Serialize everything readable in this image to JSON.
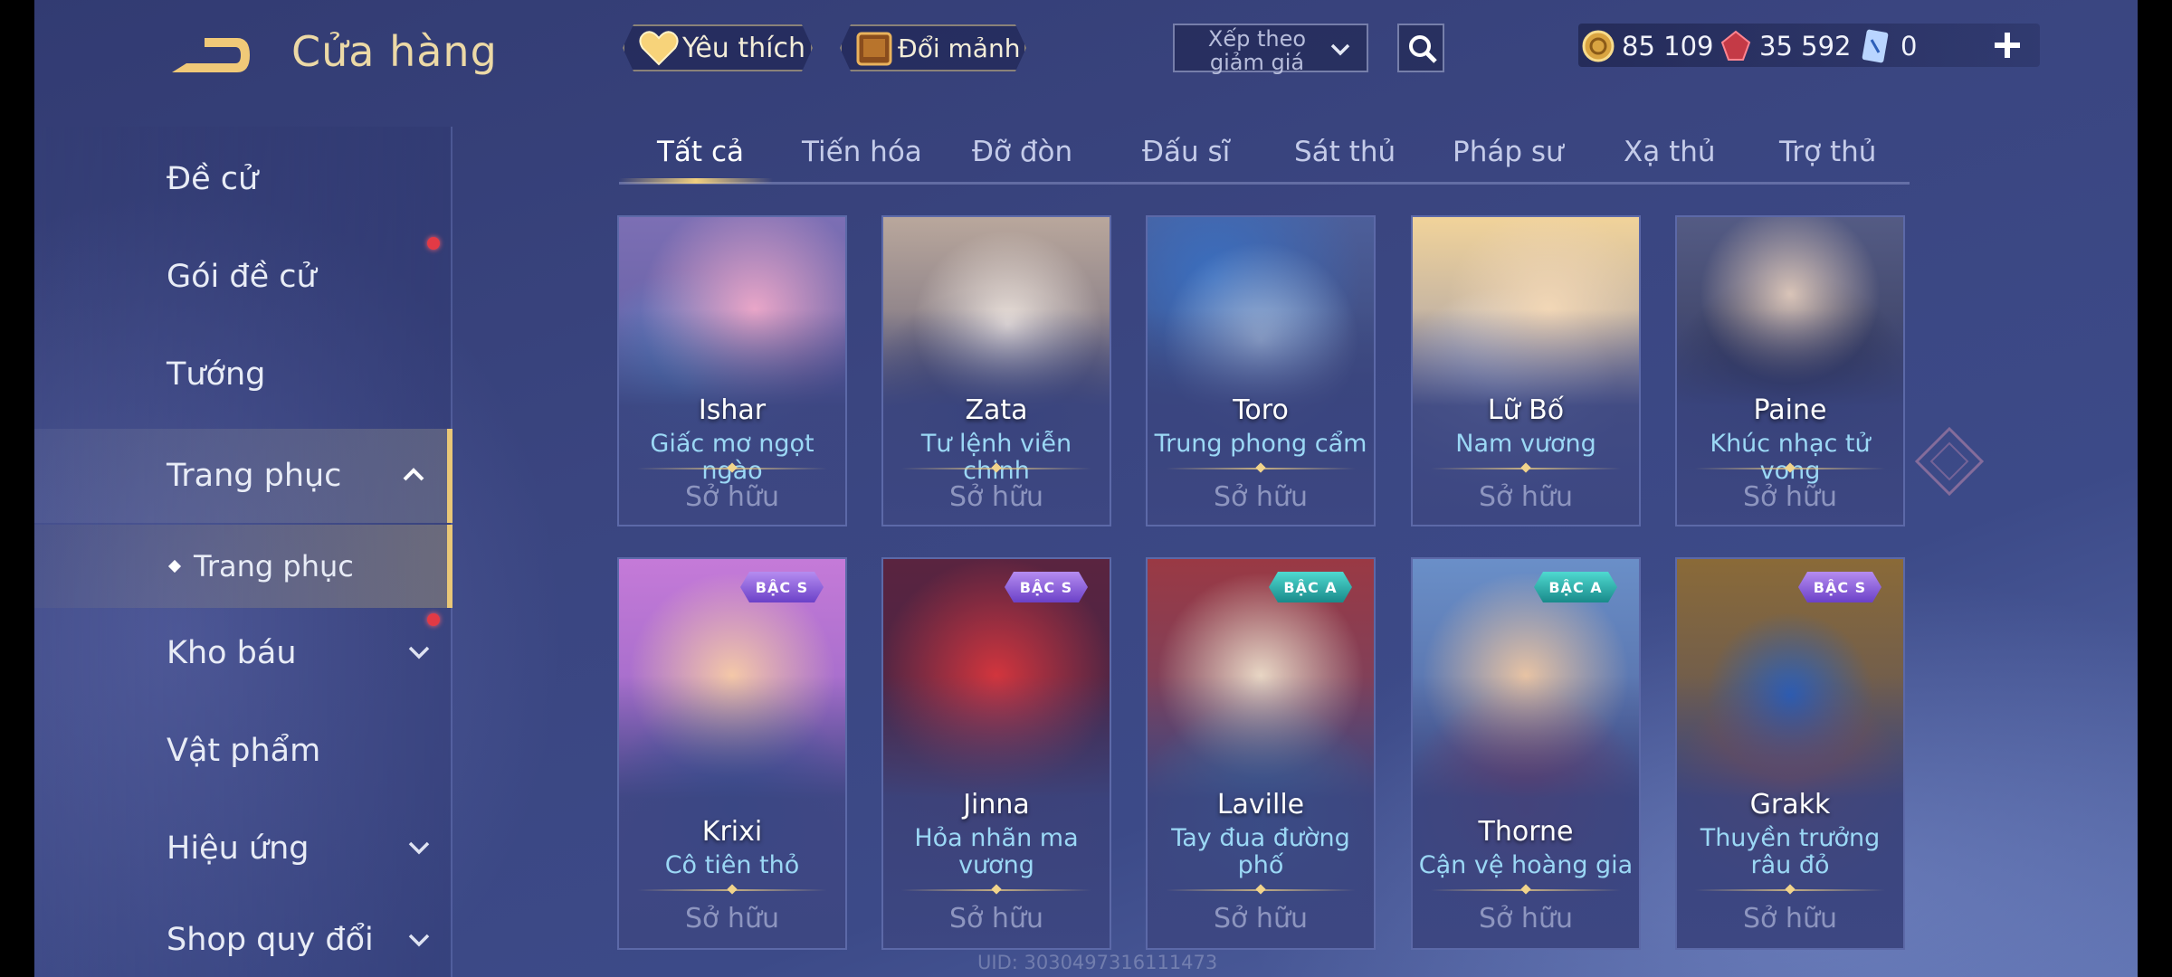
{
  "header": {
    "title": "Cửa hàng",
    "favorite_label": "Yêu thích",
    "shards_label": "Đổi mảnh",
    "sort_label": "Xếp theo giảm giá",
    "currencies": [
      {
        "icon": "gold-coin-icon",
        "value": "85 109"
      },
      {
        "icon": "red-gem-icon",
        "value": "35 592"
      },
      {
        "icon": "voucher-icon",
        "value": "0"
      }
    ]
  },
  "sidebar": {
    "items": [
      {
        "label": "Đề cử"
      },
      {
        "label": "Gói đề cử"
      },
      {
        "label": "Tướng"
      },
      {
        "label": "Trang phục"
      },
      {
        "label": "Trang phục"
      },
      {
        "label": "Kho báu"
      },
      {
        "label": "Vật phẩm"
      },
      {
        "label": "Hiệu ứng"
      },
      {
        "label": "Shop quy đổi"
      }
    ]
  },
  "tabs": [
    "Tất cả",
    "Tiến hóa",
    "Đỡ đòn",
    "Đấu sĩ",
    "Sát thủ",
    "Pháp sư",
    "Xạ thủ",
    "Trợ thủ"
  ],
  "cards": [
    {
      "hero": "Ishar",
      "skin": "Giấc mơ ngọt ngào",
      "status": "Sở hữu"
    },
    {
      "hero": "Zata",
      "skin": "Tư lệnh viễn chinh",
      "status": "Sở hữu"
    },
    {
      "hero": "Toro",
      "skin": "Trung phong cẩm",
      "status": "Sở hữu"
    },
    {
      "hero": "Lữ Bố",
      "skin": "Nam vương",
      "status": "Sở hữu"
    },
    {
      "hero": "Paine",
      "skin": "Khúc nhạc tử vong",
      "status": "Sở hữu"
    },
    {
      "hero": "Krixi",
      "skin": "Cô tiên thỏ",
      "status": "Sở hữu",
      "tier": "BẬC S"
    },
    {
      "hero": "Jinna",
      "skin": "Hỏa nhãn ma vương",
      "status": "Sở hữu",
      "tier": "BẬC S"
    },
    {
      "hero": "Laville",
      "skin": "Tay đua đường phố",
      "status": "Sở hữu",
      "tier": "BẬC A"
    },
    {
      "hero": "Thorne",
      "skin": "Cận vệ hoàng gia",
      "status": "Sở hữu",
      "tier": "BẬC A"
    },
    {
      "hero": "Grakk",
      "skin": "Thuyền trưởng râu đỏ",
      "status": "Sở hữu",
      "tier": "BẬC S"
    }
  ],
  "footer": {
    "uid": "UID: 3030497316111473"
  },
  "colors": {
    "accent_gold": "#e9c777",
    "skin_text": "#9bd8f5",
    "notification": "#e33a45"
  }
}
